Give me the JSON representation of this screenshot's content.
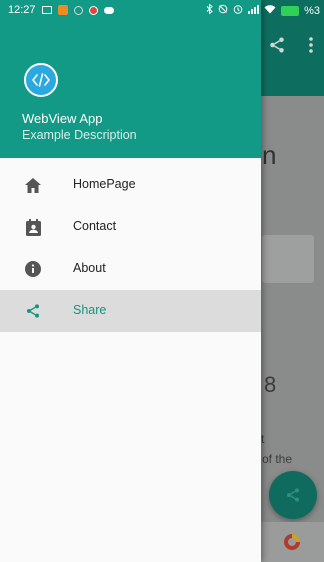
{
  "status_bar": {
    "time": "12:27",
    "battery": "%3"
  },
  "colors": {
    "primary": "#129a86",
    "primary_dark": "#0d6e60",
    "selected_bg": "#dcdcdc",
    "selected_text": "#159581",
    "icon_gray": "#555555"
  },
  "drawer": {
    "header": {
      "logo_icon": "code-icon",
      "title": "WebView App",
      "subtitle": "Example Description"
    },
    "items": [
      {
        "label": "HomePage",
        "icon": "home-icon",
        "selected": false
      },
      {
        "label": "Contact",
        "icon": "contact-icon",
        "selected": false
      },
      {
        "label": "About",
        "icon": "info-icon",
        "selected": false
      },
      {
        "label": "Share",
        "icon": "share-icon",
        "selected": true
      }
    ]
  },
  "background": {
    "heading_fragment": "n",
    "number_fragment": "8",
    "text_fragment_1": "t",
    "text_fragment_2": "of the"
  }
}
